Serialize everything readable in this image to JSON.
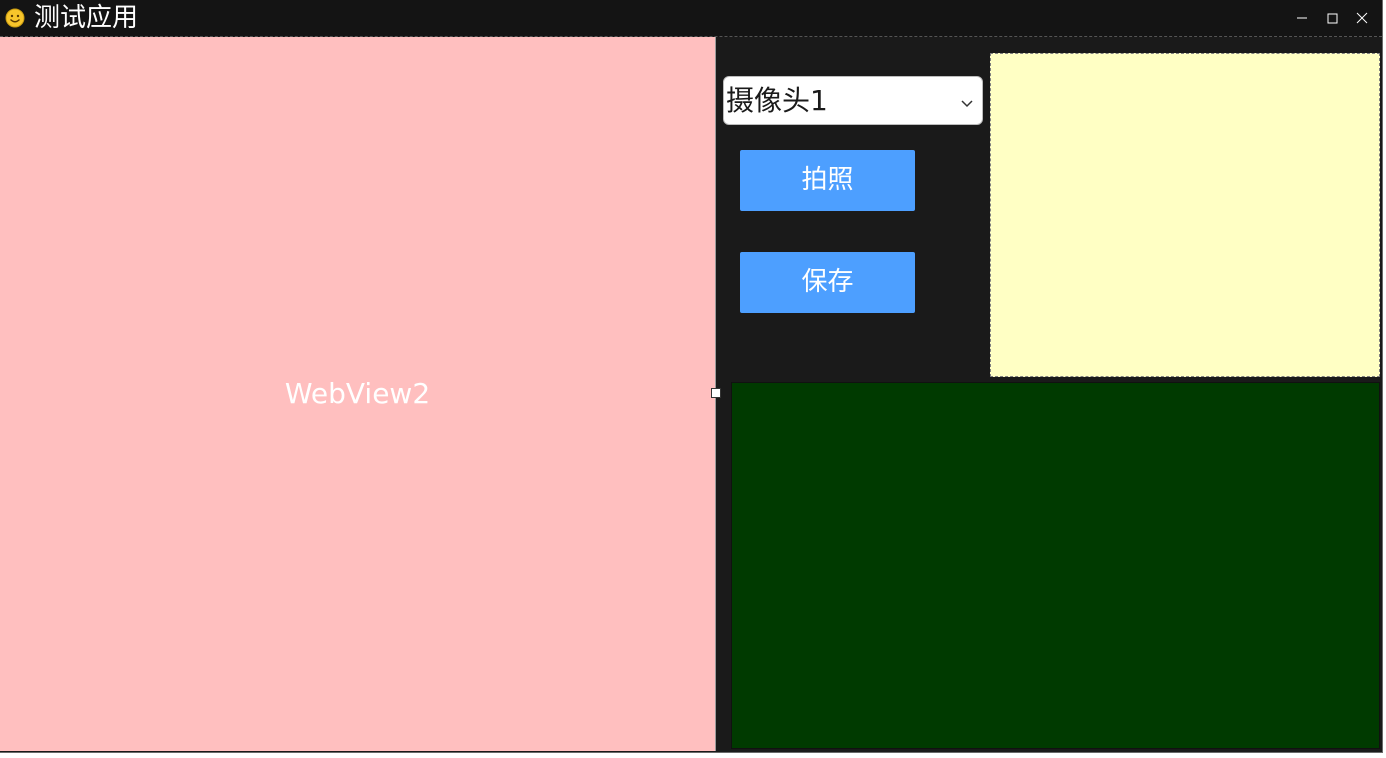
{
  "window": {
    "title": "测试应用",
    "icon": "smiley-icon",
    "controls": {
      "minimize": "minimize-icon",
      "maximize": "maximize-icon",
      "close": "close-icon"
    }
  },
  "left_pane": {
    "label": "WebView2",
    "background": "#ffbfbf"
  },
  "camera_select": {
    "value": "摄像头1"
  },
  "buttons": {
    "capture_label": "拍照",
    "save_label": "保存",
    "color": "#4d9fff"
  },
  "panels": {
    "preview_color": "#ffffc4",
    "video_color": "#003a00"
  }
}
